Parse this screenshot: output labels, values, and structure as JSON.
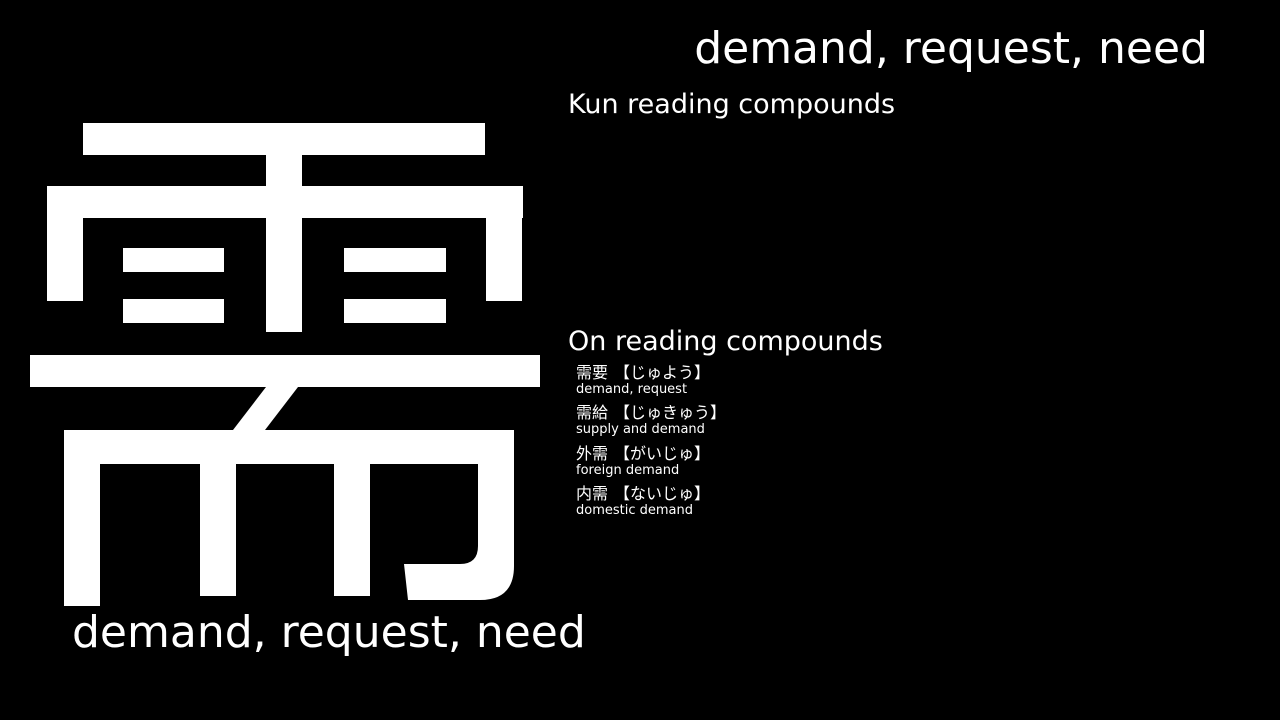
{
  "kanji": {
    "character": "需",
    "meaning_top": "demand, request, need",
    "meaning_bottom": "demand, request, need"
  },
  "kun": {
    "heading": "Kun reading compounds",
    "items": []
  },
  "on": {
    "heading": "On reading compounds",
    "items": [
      {
        "word": "需要",
        "reading": "【じゅよう】",
        "meaning": "demand, request"
      },
      {
        "word": "需給",
        "reading": "【じゅきゅう】",
        "meaning": "supply and demand"
      },
      {
        "word": "外需",
        "reading": "【がいじゅ】",
        "meaning": "foreign demand"
      },
      {
        "word": "内需",
        "reading": "【ないじゅ】",
        "meaning": "domestic demand"
      }
    ]
  },
  "colors": {
    "background": "#000000",
    "text": "#ffffff"
  }
}
